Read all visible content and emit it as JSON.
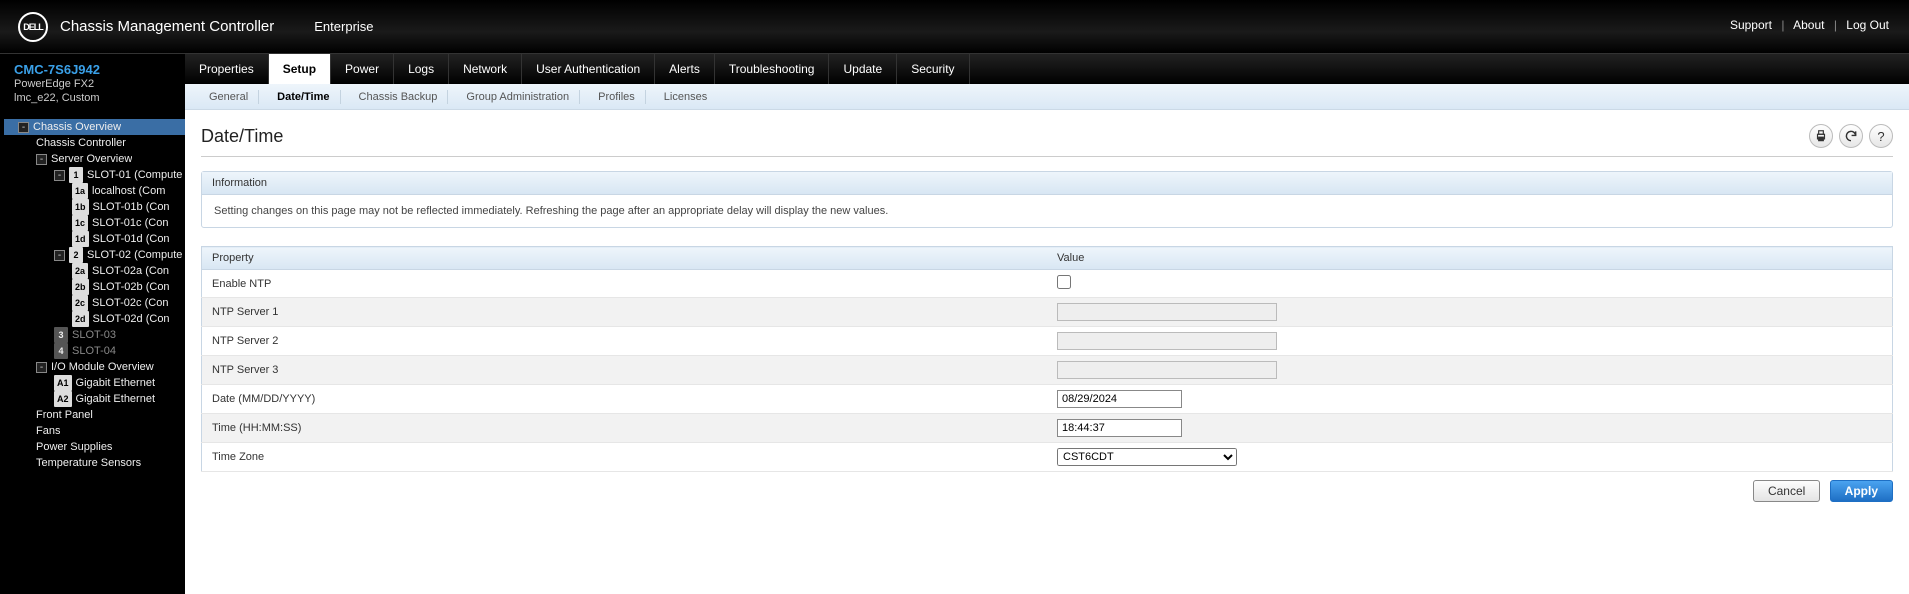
{
  "header": {
    "brand": "DELL",
    "product": "Chassis Management Controller",
    "context": "Enterprise",
    "links": {
      "support": "Support",
      "about": "About",
      "logout": "Log Out"
    }
  },
  "system": {
    "name": "CMC-7S6J942",
    "model": "PowerEdge FX2",
    "location": "lmc_e22, Custom"
  },
  "tree": [
    {
      "indent": 0,
      "toggle": "-",
      "label": "Chassis Overview",
      "sel": true
    },
    {
      "indent": 1,
      "label": "Chassis Controller"
    },
    {
      "indent": 1,
      "toggle": "-",
      "label": "Server Overview"
    },
    {
      "indent": 2,
      "toggle": "-",
      "badge": "1",
      "label": "SLOT-01 (Compute"
    },
    {
      "indent": 3,
      "badge": "1a",
      "label": "localhost (Com"
    },
    {
      "indent": 3,
      "badge": "1b",
      "label": "SLOT-01b (Con"
    },
    {
      "indent": 3,
      "badge": "1c",
      "label": "SLOT-01c (Con"
    },
    {
      "indent": 3,
      "badge": "1d",
      "label": "SLOT-01d (Con"
    },
    {
      "indent": 2,
      "toggle": "-",
      "badge": "2",
      "label": "SLOT-02 (Compute"
    },
    {
      "indent": 3,
      "badge": "2a",
      "label": "SLOT-02a (Con"
    },
    {
      "indent": 3,
      "badge": "2b",
      "label": "SLOT-02b (Con"
    },
    {
      "indent": 3,
      "badge": "2c",
      "label": "SLOT-02c (Con"
    },
    {
      "indent": 3,
      "badge": "2d",
      "label": "SLOT-02d (Con"
    },
    {
      "indent": 2,
      "badge": "3",
      "dark": true,
      "label": "SLOT-03",
      "dim": true
    },
    {
      "indent": 2,
      "badge": "4",
      "dark": true,
      "label": "SLOT-04",
      "dim": true
    },
    {
      "indent": 1,
      "toggle": "-",
      "label": "I/O Module Overview"
    },
    {
      "indent": 2,
      "badge": "A1",
      "label": "Gigabit Ethernet"
    },
    {
      "indent": 2,
      "badge": "A2",
      "label": "Gigabit Ethernet"
    },
    {
      "indent": 1,
      "label": "Front Panel"
    },
    {
      "indent": 1,
      "label": "Fans"
    },
    {
      "indent": 1,
      "label": "Power Supplies"
    },
    {
      "indent": 1,
      "label": "Temperature Sensors"
    }
  ],
  "tabs": {
    "primary": [
      "Properties",
      "Setup",
      "Power",
      "Logs",
      "Network",
      "User Authentication",
      "Alerts",
      "Troubleshooting",
      "Update",
      "Security"
    ],
    "primary_active": 1,
    "secondary": [
      "General",
      "Date/Time",
      "Chassis Backup",
      "Group Administration",
      "Profiles",
      "Licenses"
    ],
    "secondary_active": 1
  },
  "page": {
    "title": "Date/Time",
    "infobox_title": "Information",
    "infobox_body": "Setting changes on this page may not be reflected immediately. Refreshing the page after an appropriate delay will display the new values.",
    "col_property": "Property",
    "col_value": "Value",
    "rows": {
      "enable_ntp": "Enable NTP",
      "ntp1": "NTP Server 1",
      "ntp2": "NTP Server 2",
      "ntp3": "NTP Server 3",
      "date": "Date (MM/DD/YYYY)",
      "time": "Time (HH:MM:SS)",
      "tz": "Time Zone"
    },
    "values": {
      "enable_ntp": false,
      "ntp1": "",
      "ntp2": "",
      "ntp3": "",
      "date": "08/29/2024",
      "time": "18:44:37",
      "tz": "CST6CDT"
    },
    "buttons": {
      "cancel": "Cancel",
      "apply": "Apply"
    }
  }
}
